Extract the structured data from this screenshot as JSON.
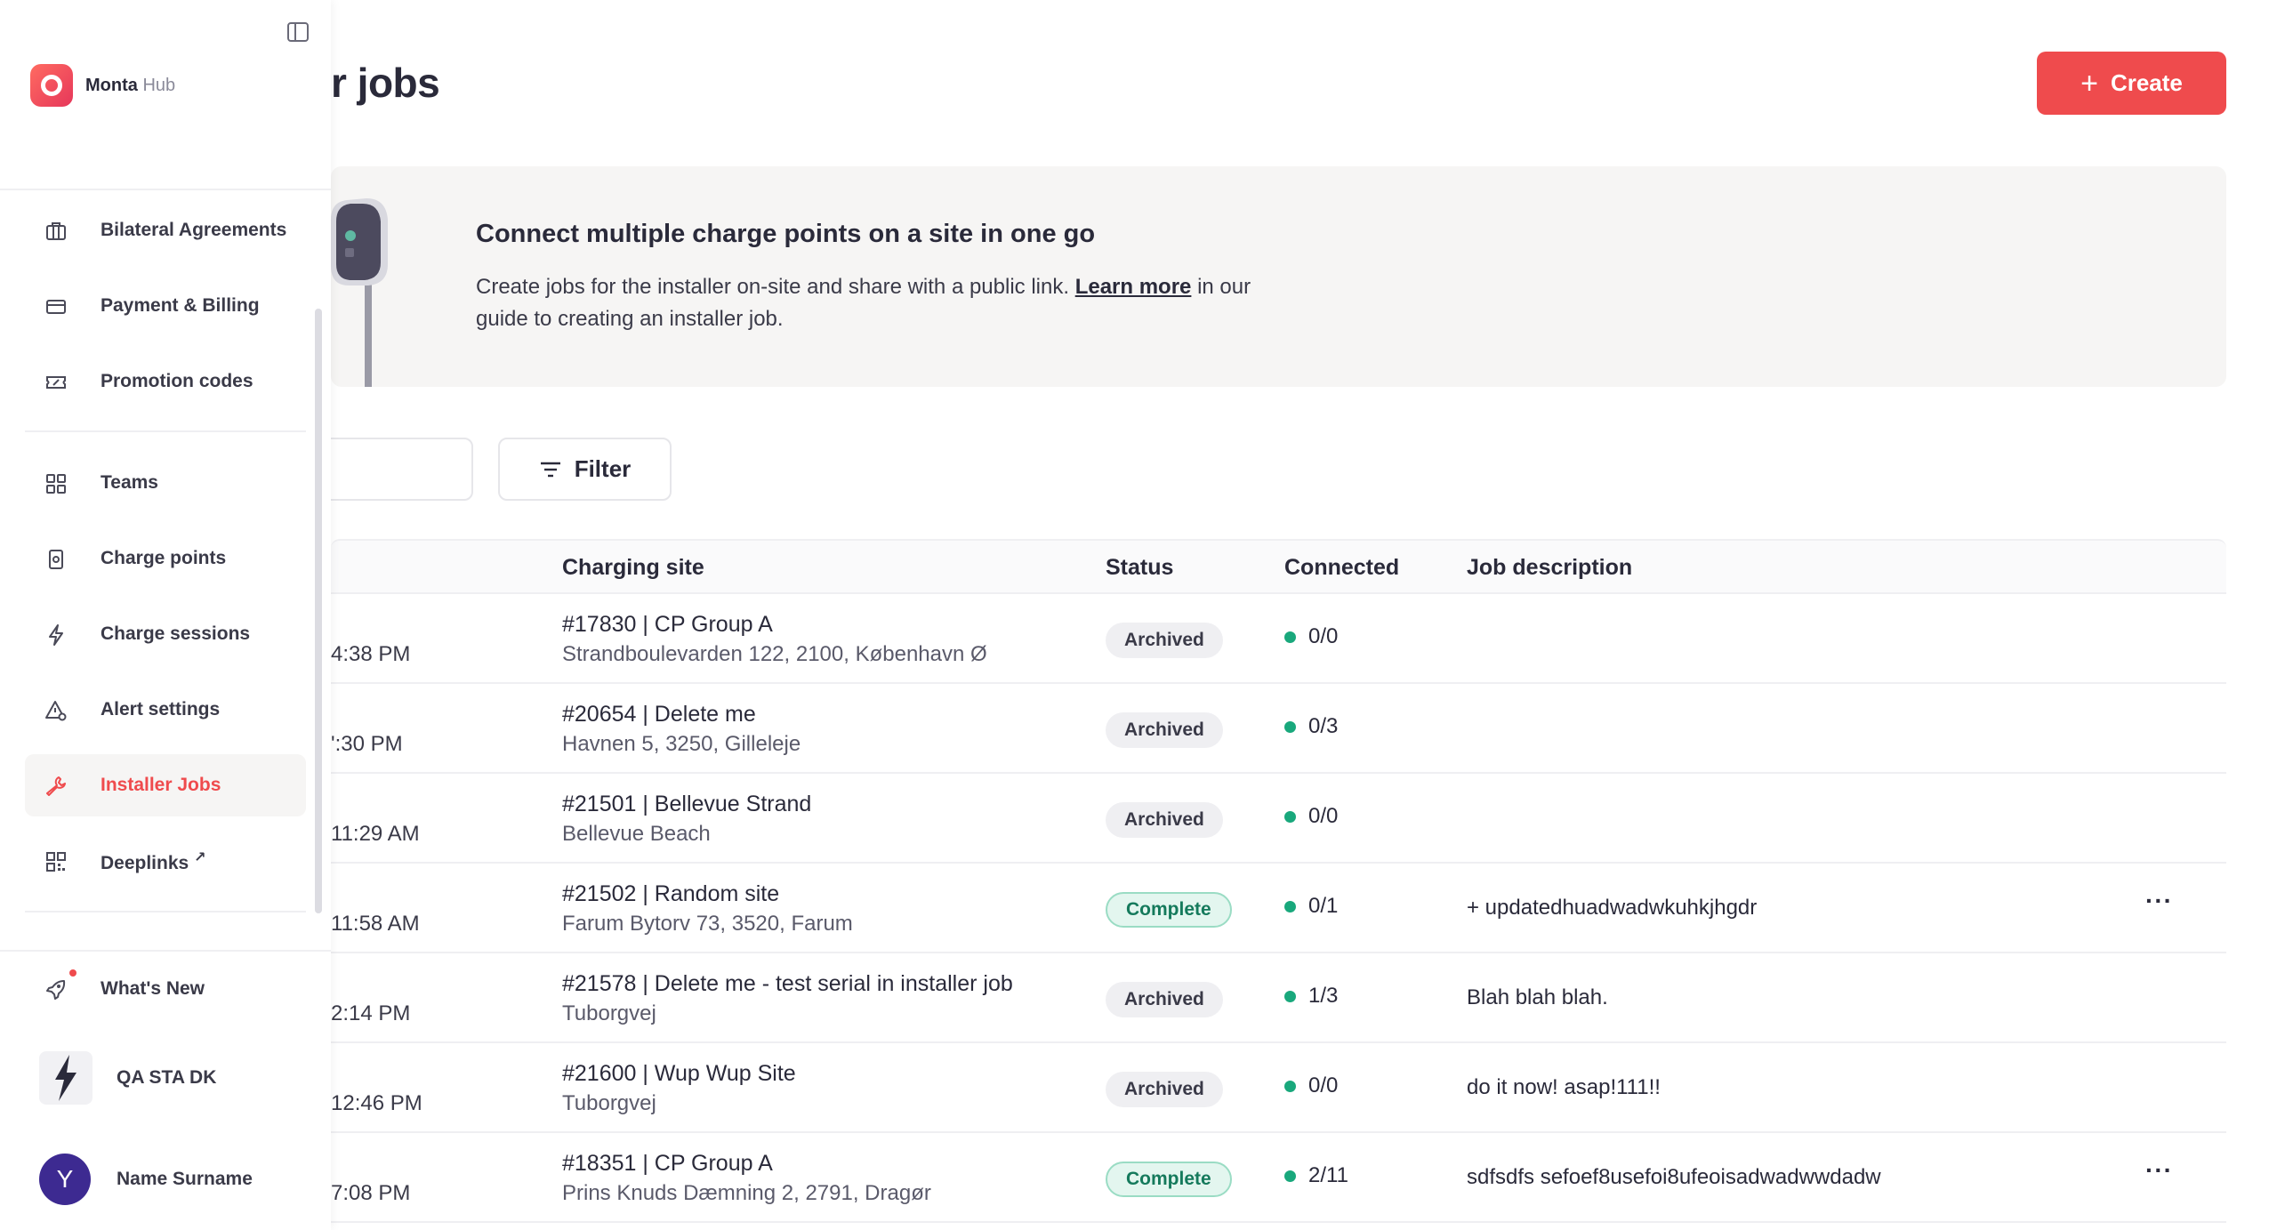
{
  "sidebar": {
    "brand_name": "Monta",
    "brand_suffix": "Hub",
    "items": [
      {
        "label": "Bilateral Agreements",
        "icon": "briefcase-icon"
      },
      {
        "label": "Payment & Billing",
        "icon": "credit-card-icon"
      },
      {
        "label": "Promotion codes",
        "icon": "ticket-icon"
      },
      {
        "label": "Teams",
        "icon": "grid-icon"
      },
      {
        "label": "Charge points",
        "icon": "charge-point-icon"
      },
      {
        "label": "Charge sessions",
        "icon": "lightning-icon"
      },
      {
        "label": "Alert settings",
        "icon": "alert-settings-icon"
      },
      {
        "label": "Installer Jobs",
        "icon": "wrench-icon",
        "active": true
      },
      {
        "label": "Deeplinks",
        "icon": "qr-code-icon",
        "external": "↗"
      }
    ],
    "whats_new": "What's New",
    "org_name": "QA STA DK",
    "user_initial": "Y",
    "user_name": "Name Surname"
  },
  "header": {
    "title": "r jobs",
    "create_label": "Create"
  },
  "banner": {
    "title": "Connect multiple charge points on a site in one go",
    "text_before": "Create jobs for the installer on-site and share with a public link. ",
    "link": "Learn more",
    "text_after": " in our guide to creating an installer job."
  },
  "toolbar": {
    "filter_label": "Filter"
  },
  "table": {
    "columns": {
      "site": "Charging site",
      "status": "Status",
      "connected": "Connected",
      "description": "Job description"
    },
    "rows": [
      {
        "date": "4:38 PM",
        "site_name": "#17830 | CP Group A",
        "site_addr": "Strandboulevarden 122, 2100, København Ø",
        "status": "Archived",
        "status_kind": "archived",
        "connected": "0/0",
        "description": "",
        "more": ""
      },
      {
        "date": "':30 PM",
        "site_name": "#20654 | Delete me",
        "site_addr": "Havnen 5, 3250, Gilleleje",
        "status": "Archived",
        "status_kind": "archived",
        "connected": "0/3",
        "description": "",
        "more": ""
      },
      {
        "date": "11:29 AM",
        "site_name": "#21501 | Bellevue Strand",
        "site_addr": "Bellevue Beach",
        "status": "Archived",
        "status_kind": "archived",
        "connected": "0/0",
        "description": "",
        "more": ""
      },
      {
        "date": "11:58 AM",
        "site_name": "#21502 | Random site",
        "site_addr": "Farum Bytorv 73, 3520, Farum",
        "status": "Complete",
        "status_kind": "complete",
        "connected": "0/1",
        "description": "+ updatedhuadwadwkuhkjhgdr",
        "more": "···"
      },
      {
        "date": "2:14 PM",
        "site_name": "#21578 | Delete me - test serial in installer job",
        "site_addr": "Tuborgvej",
        "status": "Archived",
        "status_kind": "archived",
        "connected": "1/3",
        "description": "Blah blah blah.",
        "more": ""
      },
      {
        "date": "12:46 PM",
        "site_name": "#21600 | Wup Wup Site",
        "site_addr": "Tuborgvej",
        "status": "Archived",
        "status_kind": "archived",
        "connected": "0/0",
        "description": "do it now! asap!111!!",
        "more": ""
      },
      {
        "date": "7:08 PM",
        "site_name": "#18351 | CP Group A",
        "site_addr": "Prins Knuds Dæmning 2, 2791, Dragør",
        "status": "Complete",
        "status_kind": "complete",
        "connected": "2/11",
        "description": "sdfsdfs sefoef8usefoi8ufeoisadwadwwdadw",
        "more": "···"
      }
    ]
  },
  "colors": {
    "accent": "#ef4b4d",
    "connected_dot": "#19a87c",
    "complete_badge_bg": "#e3f6ef",
    "archived_badge_bg": "#efeff2",
    "avatar": "#3d2a91"
  }
}
